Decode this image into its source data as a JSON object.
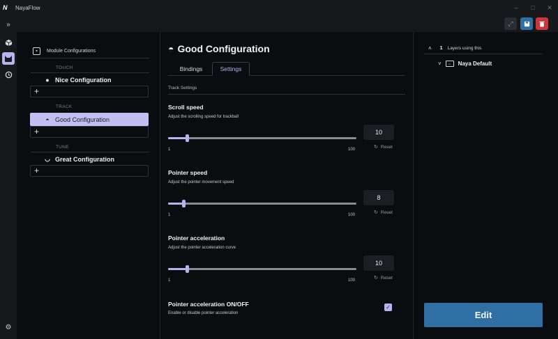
{
  "app": {
    "logo": "N",
    "title": "NayaFlow"
  },
  "window_controls": {
    "minimize": "–",
    "maximize": "□",
    "close": "✕"
  },
  "rail": {
    "expand_icon": "»",
    "items": [
      "cube-icon",
      "cat-icon",
      "history-icon"
    ],
    "settings_icon": "⚙"
  },
  "actions": {
    "colors": {
      "expand": "#2b2c33",
      "save": "#2f6fa3",
      "delete": "#c9373c"
    }
  },
  "modules": {
    "header": "Module Configurations",
    "groups": [
      {
        "label": "TOUCH",
        "item": "Nice Configuration",
        "add": "+"
      },
      {
        "label": "TRACK",
        "item": "Good Configuration",
        "add": "+"
      },
      {
        "label": "TUNE",
        "item": "Great Configuration",
        "add": "+"
      }
    ]
  },
  "config": {
    "title": "Good Configuration",
    "tabs": [
      "Bindings",
      "Settings"
    ],
    "active_tab": "Settings",
    "section": "Track Settings",
    "settings": [
      {
        "title": "Scroll speed",
        "desc": "Adjust the scrolling speed for trackball",
        "min": "1",
        "max": "100",
        "value": "10",
        "fraction": 0.1,
        "reset": "Reset"
      },
      {
        "title": "Pointer speed",
        "desc": "Adjust the pointer movement speed",
        "min": "1",
        "max": "100",
        "value": "8",
        "fraction": 0.08,
        "reset": "Reset"
      },
      {
        "title": "Pointer acceleration",
        "desc": "Adjust the pointer acceleration curve",
        "min": "1",
        "max": "100",
        "value": "10",
        "fraction": 0.1,
        "reset": "Reset"
      }
    ],
    "toggle": {
      "title": "Pointer acceleration ON/OFF",
      "desc": "Enable or disable pointer acceleration",
      "checked": true
    }
  },
  "layers": {
    "count": "1",
    "label": "Layers using this",
    "items": [
      "Naya Default"
    ]
  },
  "edit_button": "Edit",
  "colors": {
    "accent": "#b9b2ee",
    "selected_bg": "#c3bdf2",
    "edit": "#2f6fa3",
    "background": "#0b0c10"
  }
}
